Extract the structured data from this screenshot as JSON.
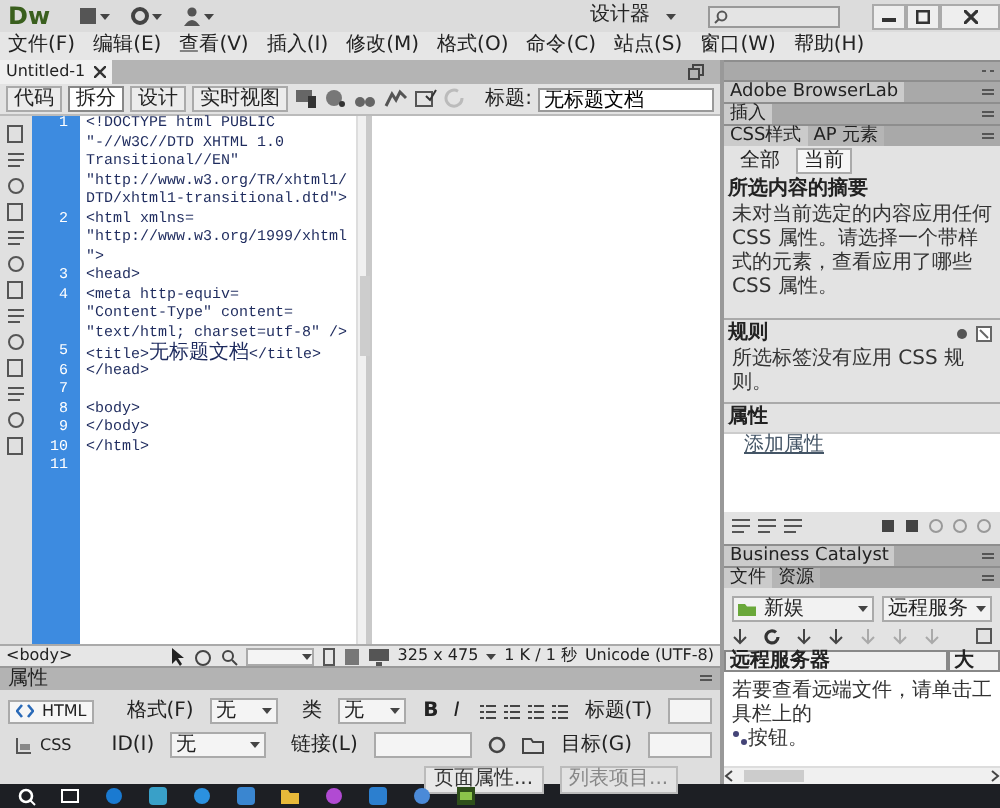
{
  "app": {
    "logo": "Dw",
    "workspace": "设计器"
  },
  "menu": [
    "文件(F)",
    "编辑(E)",
    "查看(V)",
    "插入(I)",
    "修改(M)",
    "格式(O)",
    "命令(C)",
    "站点(S)",
    "窗口(W)",
    "帮助(H)"
  ],
  "document_tabs": [
    {
      "label": "Untitled-1",
      "selected": true
    }
  ],
  "view_buttons": [
    {
      "label": "代码",
      "selected": false
    },
    {
      "label": "拆分",
      "selected": true
    },
    {
      "label": "设计",
      "selected": false
    },
    {
      "label": "实时视图",
      "selected": false
    }
  ],
  "title_field": {
    "label": "标题:",
    "value": "无标题文档"
  },
  "code_lines": [
    {
      "number": "1",
      "text": "<!DOCTYPE html PUBLIC"
    },
    {
      "text": "\"-//W3C//DTD XHTML 1.0"
    },
    {
      "text": "Transitional//EN\""
    },
    {
      "text": "\"http://www.w3.org/TR/xhtml1/"
    },
    {
      "text": "DTD/xhtml1-transitional.dtd\">"
    },
    {
      "number": "2",
      "text": "<html xmlns="
    },
    {
      "text": "\"http://www.w3.org/1999/xhtml"
    },
    {
      "text": "\">"
    },
    {
      "number": "3",
      "text": "<head>"
    },
    {
      "number": "4",
      "text": "<meta http-equiv="
    },
    {
      "text": "\"Content-Type\" content="
    },
    {
      "text": "\"text/html; charset=utf-8\" />"
    },
    {
      "number": "5",
      "text": "<title>无标题文档</title>"
    },
    {
      "number": "6",
      "text": "</head>"
    },
    {
      "number": "7"
    },
    {
      "number": "8",
      "text": "<body>"
    },
    {
      "number": "9",
      "text": "</body>"
    },
    {
      "number": "10",
      "text": "</html>"
    },
    {
      "number": "11"
    }
  ],
  "status_bar": {
    "tag": "<body>",
    "size": "325 x 475",
    "download": "1 K / 1 秒",
    "encoding": "Unicode (UTF-8)"
  },
  "properties": {
    "title": "属性",
    "modes": [
      {
        "label": "HTML",
        "selected": true
      },
      {
        "label": "CSS",
        "selected": false
      }
    ],
    "format_label": "格式(F)",
    "format": "无",
    "id_label": "ID(I)",
    "id": "无",
    "class_label": "类",
    "class": "无",
    "link_label": "链接(L)",
    "bold": "B",
    "italic": "I",
    "title_label": "标题(T)",
    "target_label": "目标(G)",
    "buttons": [
      "页面属性...",
      "列表项目..."
    ]
  },
  "panels": [
    {
      "title": "Adobe BrowserLab"
    },
    {
      "title": "插入"
    }
  ],
  "css_styles": {
    "tabs": [
      {
        "label": "CSS样式",
        "selected": true
      },
      {
        "label": "AP 元素",
        "selected": false
      }
    ],
    "modes": [
      {
        "label": "全部",
        "selected": false
      },
      {
        "label": "当前",
        "selected": true
      }
    ],
    "summary_heading": "所选内容的摘要",
    "summary_text": "未对当前选定的内容应用任何 CSS 属性。请选择一个带样式的元素，查看应用了哪些 CSS 属性。",
    "rules_heading": "规则",
    "rules_text": "所选标签没有应用 CSS 规则。",
    "properties_heading": "属性",
    "add_property": "添加属性"
  },
  "business_catalyst": {
    "title": "Business Catalyst"
  },
  "files": {
    "tabs": [
      {
        "label": "文件",
        "selected": true
      },
      {
        "label": "资源",
        "selected": false
      }
    ],
    "site": "新娱",
    "view": "远程服务",
    "columns": [
      "远程服务器",
      "大"
    ],
    "message_before": "若要查看远端文件，请单击工具栏上的",
    "message_after": "按钮。"
  }
}
